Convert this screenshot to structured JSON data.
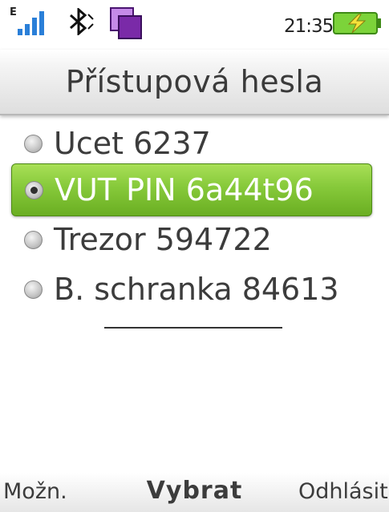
{
  "status_bar": {
    "network_type": "E",
    "signal_icon": "signal-strength-icon",
    "bluetooth_icon": "bluetooth-icon",
    "app_icon": "multitask-icon",
    "time": "21:35",
    "battery_icon": "battery-charging-icon"
  },
  "title": "Přístupová hesla",
  "list": {
    "items": [
      {
        "label": "Ucet  6237",
        "selected": false
      },
      {
        "label": "VUT PIN 6a44t96",
        "selected": true
      },
      {
        "label": "Trezor 594722",
        "selected": false
      },
      {
        "label": "B. schranka 84613",
        "selected": false
      }
    ]
  },
  "softkeys": {
    "left": "Možn.",
    "center": "Vybrat",
    "right": "Odhlásit"
  },
  "colors": {
    "selection": "#86c93a",
    "battery": "#7cd33a",
    "app_icon": "#7a2aa8"
  }
}
